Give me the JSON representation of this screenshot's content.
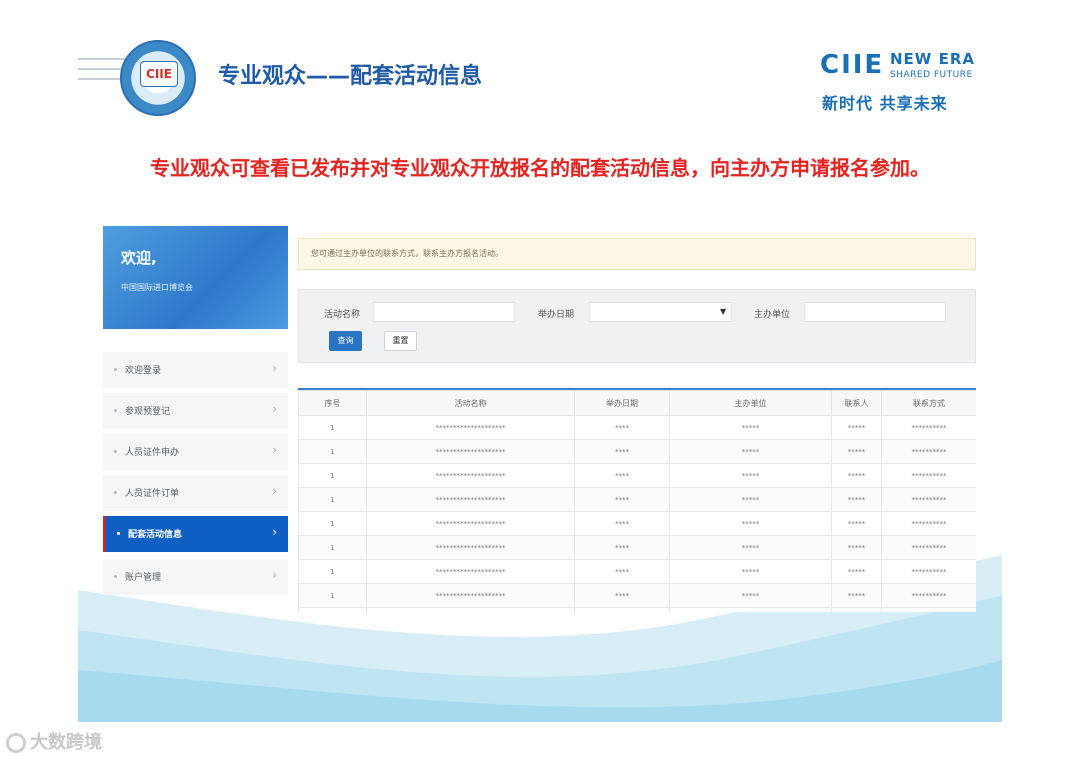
{
  "header": {
    "logo_text": "CIIE",
    "title": "专业观众——配套活动信息",
    "brand": {
      "ciie": "CIIE",
      "new_era": "NEW ERA",
      "shared_future": "SHARED FUTURE",
      "slogan": "新时代 共享未来"
    }
  },
  "headline": "专业观众可查看已发布并对专业观众开放报名的配套活动信息，向主办方申请报名参加。",
  "sidebar": {
    "welcome_title": "欢迎,",
    "welcome_sub": "中国国际进口博览会",
    "items": [
      {
        "label": "欢迎登录",
        "active": false
      },
      {
        "label": "参观预登记",
        "active": false
      },
      {
        "label": "人员证件申办",
        "active": false
      },
      {
        "label": "人员证件订单",
        "active": false
      },
      {
        "label": "配套活动信息",
        "active": true
      },
      {
        "label": "账户管理",
        "active": false
      }
    ]
  },
  "notice": "您可通过主办单位的联系方式，联系主办方报名活动。",
  "search": {
    "activity_name_label": "活动名称",
    "date_label": "举办日期",
    "organizer_label": "主办单位",
    "query_button": "查询",
    "reset_button": "重置"
  },
  "table": {
    "headers": [
      "序号",
      "活动名称",
      "举办日期",
      "主办单位",
      "联系人",
      "联系方式"
    ],
    "rows": [
      [
        "1",
        "********************",
        "****",
        "*****",
        "*****",
        "**********"
      ],
      [
        "1",
        "********************",
        "****",
        "*****",
        "*****",
        "**********"
      ],
      [
        "1",
        "********************",
        "****",
        "*****",
        "*****",
        "**********"
      ],
      [
        "1",
        "********************",
        "****",
        "*****",
        "*****",
        "**********"
      ],
      [
        "1",
        "********************",
        "****",
        "*****",
        "*****",
        "**********"
      ],
      [
        "1",
        "********************",
        "****",
        "*****",
        "*****",
        "**********"
      ],
      [
        "1",
        "********************",
        "****",
        "*****",
        "*****",
        "**********"
      ],
      [
        "1",
        "********************",
        "****",
        "*****",
        "*****",
        "**********"
      ],
      [
        "1",
        "********************",
        "****",
        "*****",
        "*****",
        "**********"
      ]
    ]
  },
  "watermark": "大数跨境",
  "colors": {
    "accent": "#1f5aa6",
    "headline": "#e32420",
    "active_menu": "#0e5fc4"
  }
}
